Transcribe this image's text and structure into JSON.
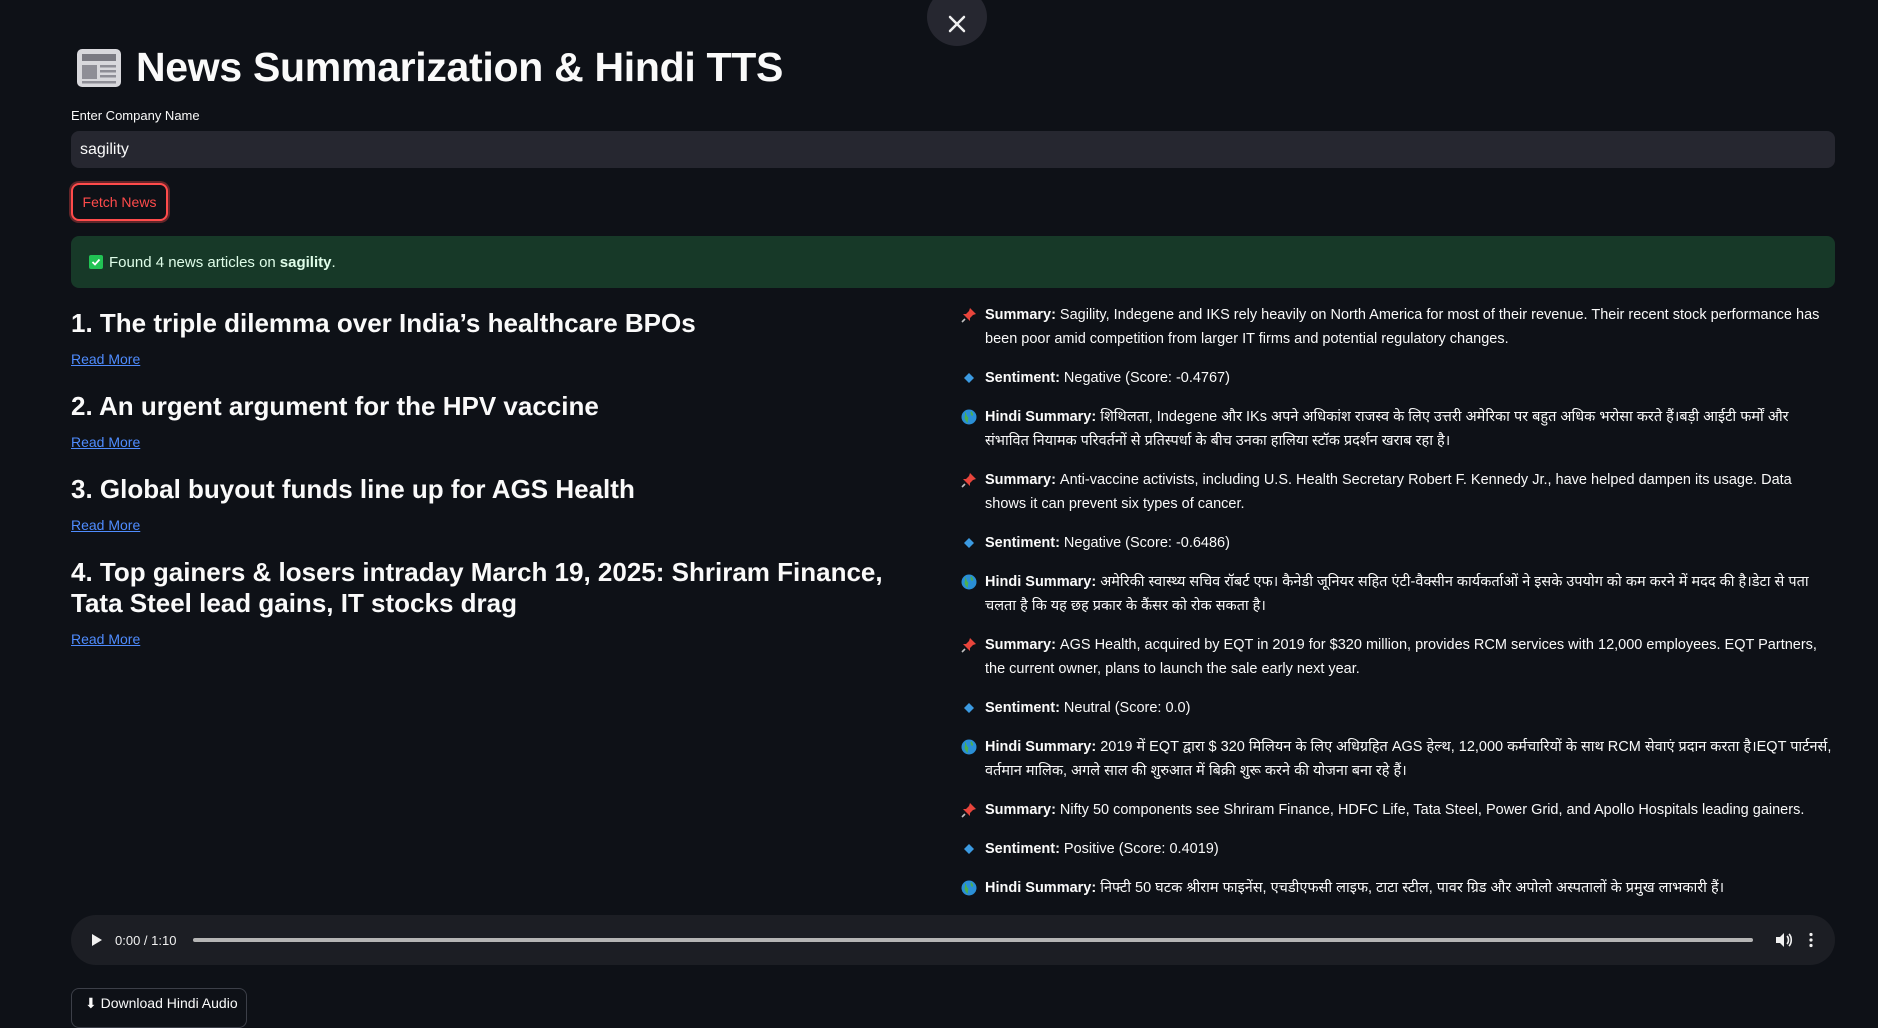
{
  "header": {
    "title": "News Summarization & Hindi TTS",
    "close_icon": "close-icon",
    "title_icon": "newspaper-icon"
  },
  "form": {
    "label": "Enter Company Name",
    "input_value": "sagility",
    "fetch_button": "Fetch News"
  },
  "status": {
    "prefix": "Found 4 news articles on",
    "company": "sagility",
    "suffix": ".",
    "color": "#173928"
  },
  "articles": [
    {
      "title": "1. The triple dilemma over India’s healthcare BPOs",
      "link": "Read More"
    },
    {
      "title": "2. An urgent argument for the HPV vaccine",
      "link": "Read More"
    },
    {
      "title": "3. Global buyout funds line up for AGS Health",
      "link": "Read More"
    },
    {
      "title": "4. Top gainers & losers intraday March 19, 2025: Shriram Finance, Tata Steel lead gains, IT stocks drag",
      "link": "Read More"
    }
  ],
  "summaries": [
    {
      "summary_label": "Summary:",
      "summary": "Sagility, Indegene and IKS rely heavily on North America for most of their revenue. Their recent stock performance has been poor amid competition from larger IT firms and potential regulatory changes.",
      "sentiment_label": "Sentiment:",
      "sentiment": "Negative (Score: -0.4767)",
      "hindi_label": "Hindi Summary:",
      "hindi": "शिथिलता, Indegene और IKs अपने अधिकांश राजस्व के लिए उत्तरी अमेरिका पर बहुत अधिक भरोसा करते हैं।बड़ी आईटी फर्मों और संभावित नियामक परिवर्तनों से प्रतिस्पर्धा के बीच उनका हालिया स्टॉक प्रदर्शन खराब रहा है।"
    },
    {
      "summary_label": "Summary:",
      "summary": "Anti-vaccine activists, including U.S. Health Secretary Robert F. Kennedy Jr., have helped dampen its usage. Data shows it can prevent six types of cancer.",
      "sentiment_label": "Sentiment:",
      "sentiment": "Negative (Score: -0.6486)",
      "hindi_label": "Hindi Summary:",
      "hindi": "अमेरिकी स्वास्थ्य सचिव रॉबर्ट एफ। कैनेडी जूनियर सहित एंटी-वैक्सीन कार्यकर्ताओं ने इसके उपयोग को कम करने में मदद की है।डेटा से पता चलता है कि यह छह प्रकार के कैंसर को रोक सकता है।"
    },
    {
      "summary_label": "Summary:",
      "summary": "AGS Health, acquired by EQT in 2019 for $320 million, provides RCM services with 12,000 employees. EQT Partners, the current owner, plans to launch the sale early next year.",
      "sentiment_label": "Sentiment:",
      "sentiment": "Neutral (Score: 0.0)",
      "hindi_label": "Hindi Summary:",
      "hindi": "2019 में EQT द्वारा $ 320 मिलियन के लिए अधिग्रहित AGS हेल्थ, 12,000 कर्मचारियों के साथ RCM सेवाएं प्रदान करता है।EQT पार्टनर्स, वर्तमान मालिक, अगले साल की शुरुआत में बिक्री शुरू करने की योजना बना रहे हैं।"
    },
    {
      "summary_label": "Summary:",
      "summary": "Nifty 50 components see Shriram Finance, HDFC Life, Tata Steel, Power Grid, and Apollo Hospitals leading gainers.",
      "sentiment_label": "Sentiment:",
      "sentiment": "Positive (Score: 0.4019)",
      "hindi_label": "Hindi Summary:",
      "hindi": "निफ्टी 50 घटक श्रीराम फाइनेंस, एचडीएफसी लाइफ, टाटा स्टील, पावर ग्रिड और अपोलो अस्पतालों के प्रमुख लाभकारी हैं।"
    }
  ],
  "audio": {
    "time": "0:00 / 1:10",
    "progress": 0
  },
  "download": {
    "label": "⬇ Download Hindi Audio"
  },
  "colors": {
    "accent": "#ff4b4b",
    "link": "#4f8cfe",
    "background": "#0e1117"
  }
}
